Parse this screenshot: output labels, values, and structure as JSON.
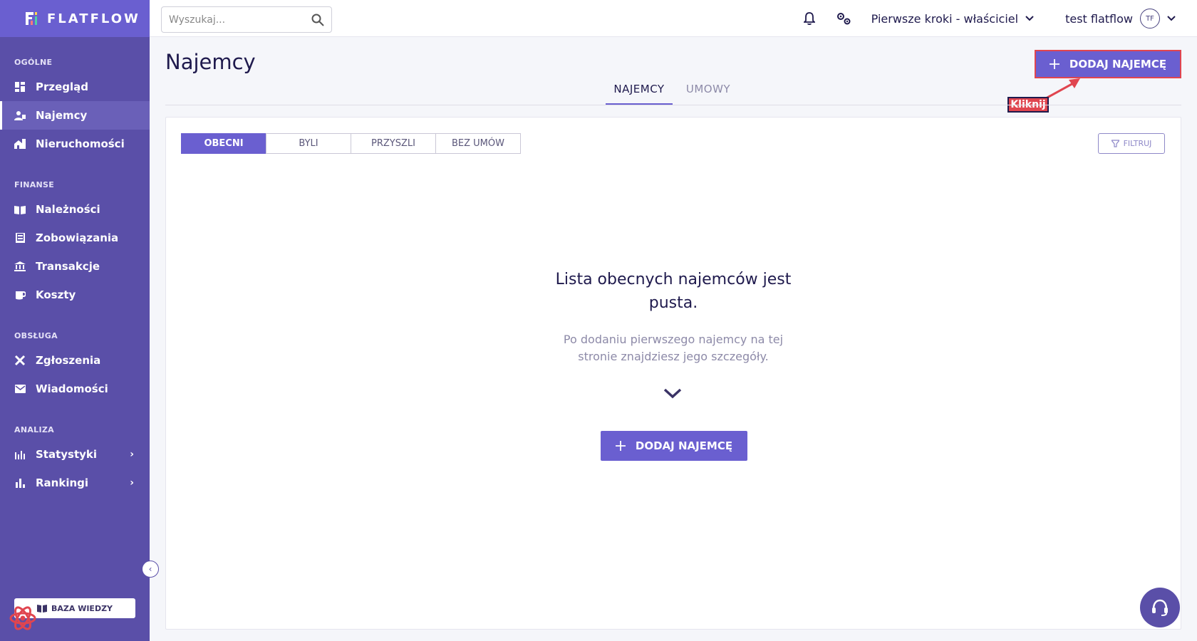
{
  "brand": {
    "name": "FLATFLOW"
  },
  "search": {
    "placeholder": "Wyszukaj..."
  },
  "topbar": {
    "context_label": "Pierwsze kroki - właściciel",
    "user_name": "test flatflow",
    "avatar_initials": "TF"
  },
  "sidebar": {
    "sections": [
      {
        "title": "OGÓLNE",
        "items": [
          {
            "label": "Przegląd",
            "icon": "dashboard-icon"
          },
          {
            "label": "Najemcy",
            "icon": "tenants-icon",
            "active": true
          },
          {
            "label": "Nieruchomości",
            "icon": "property-icon"
          }
        ]
      },
      {
        "title": "FINANSE",
        "items": [
          {
            "label": "Należności",
            "icon": "receivables-icon"
          },
          {
            "label": "Zobowiązania",
            "icon": "liabilities-icon"
          },
          {
            "label": "Transakcje",
            "icon": "bank-icon"
          },
          {
            "label": "Koszty",
            "icon": "costs-icon"
          }
        ]
      },
      {
        "title": "OBSŁUGA",
        "items": [
          {
            "label": "Zgłoszenia",
            "icon": "tools-icon"
          },
          {
            "label": "Wiadomości",
            "icon": "mail-icon"
          }
        ]
      },
      {
        "title": "ANALIZA",
        "items": [
          {
            "label": "Statystyki",
            "icon": "stats-icon"
          },
          {
            "label": "Rankingi",
            "icon": "rankings-icon"
          }
        ]
      }
    ],
    "knowledge_base": "BAZA WIEDZY"
  },
  "page": {
    "title": "Najemcy",
    "add_button": "DODAJ NAJEMCĘ",
    "tabs": [
      "NAJEMCY",
      "UMOWY"
    ],
    "annotation": "Kliknij"
  },
  "filters": {
    "segments": [
      "OBECNI",
      "BYLI",
      "PRZYSZLI",
      "BEZ UMÓW"
    ],
    "filter_button": "FILTRUJ"
  },
  "empty_state": {
    "title_line1": "Lista obecnych najemców jest",
    "title_line2": "pusta.",
    "text_line1": "Po dodaniu pierwszego najemcy na tej",
    "text_line2": "stronie znajdziesz jego szczegóły.",
    "button": "DODAJ NAJEMCĘ"
  },
  "colors": {
    "sidebar": "#5a4fa8",
    "accent": "#6a5fd0",
    "highlight": "#e0454f"
  }
}
